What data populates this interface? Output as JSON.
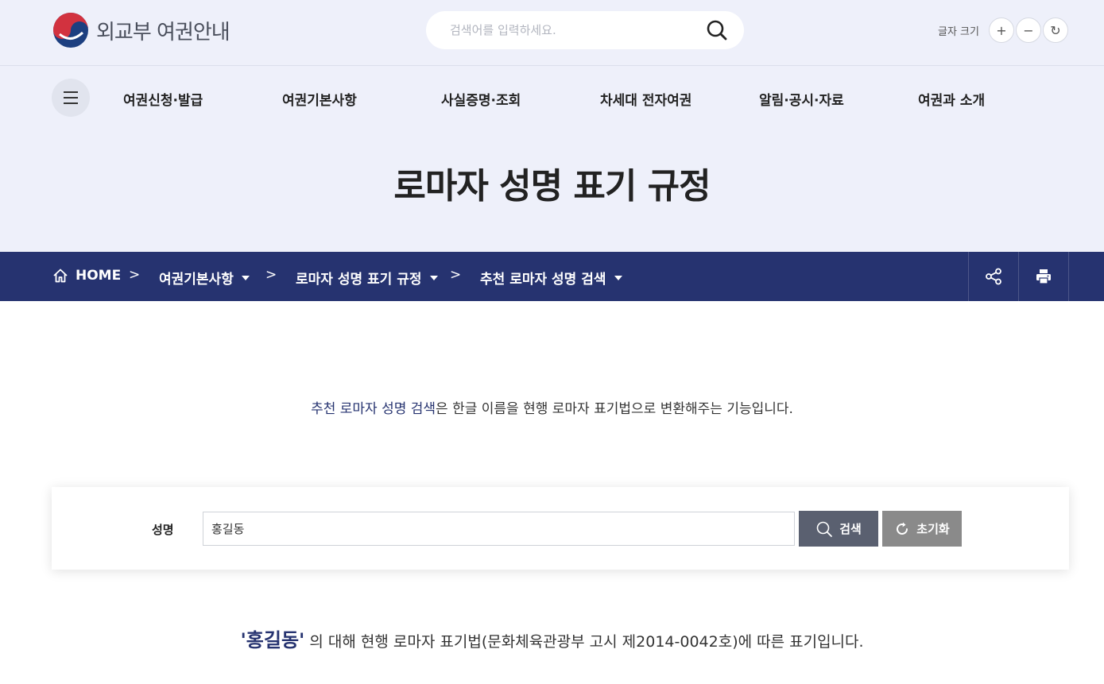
{
  "header": {
    "logo_text": "외교부 여권안내",
    "search": {
      "placeholder": "검색어를 입력하세요."
    },
    "font_size": {
      "label": "글자 크기",
      "increase": "+",
      "decrease": "−",
      "reset": "↻"
    }
  },
  "gnb": {
    "items": [
      {
        "label": "여권신청·발급"
      },
      {
        "label": "여권기본사항"
      },
      {
        "label": "사실증명·조회"
      },
      {
        "label": "차세대 전자여권"
      },
      {
        "label": "알림·공시·자료"
      },
      {
        "label": "여권과 소개"
      }
    ]
  },
  "page": {
    "title": "로마자 성명 표기 규정"
  },
  "breadcrumb": {
    "home": "HOME",
    "items": [
      {
        "label": "여권기본사항"
      },
      {
        "label": "로마자 성명 표기 규정"
      },
      {
        "label": "추천 로마자 성명 검색"
      }
    ],
    "separator": ">"
  },
  "intro": {
    "highlight": "추천 로마자 성명 검색",
    "text": "은 한글 이름을 현행 로마자 표기법으로 변환해주는 기능입니다."
  },
  "form": {
    "name_label": "성명",
    "name_value": "홍길동",
    "search_button": "검색",
    "reset_button": "초기화"
  },
  "result": {
    "query": "'홍길동'",
    "text": " 의 대해 현행 로마자 표기법(문화체육관광부 고시 제2014-0042호)에 따른 표기입니다."
  },
  "colors": {
    "header_bg": "#eef0fa",
    "navy": "#263370",
    "search_btn": "#5a6070",
    "reset_btn": "#8a8a8a"
  }
}
